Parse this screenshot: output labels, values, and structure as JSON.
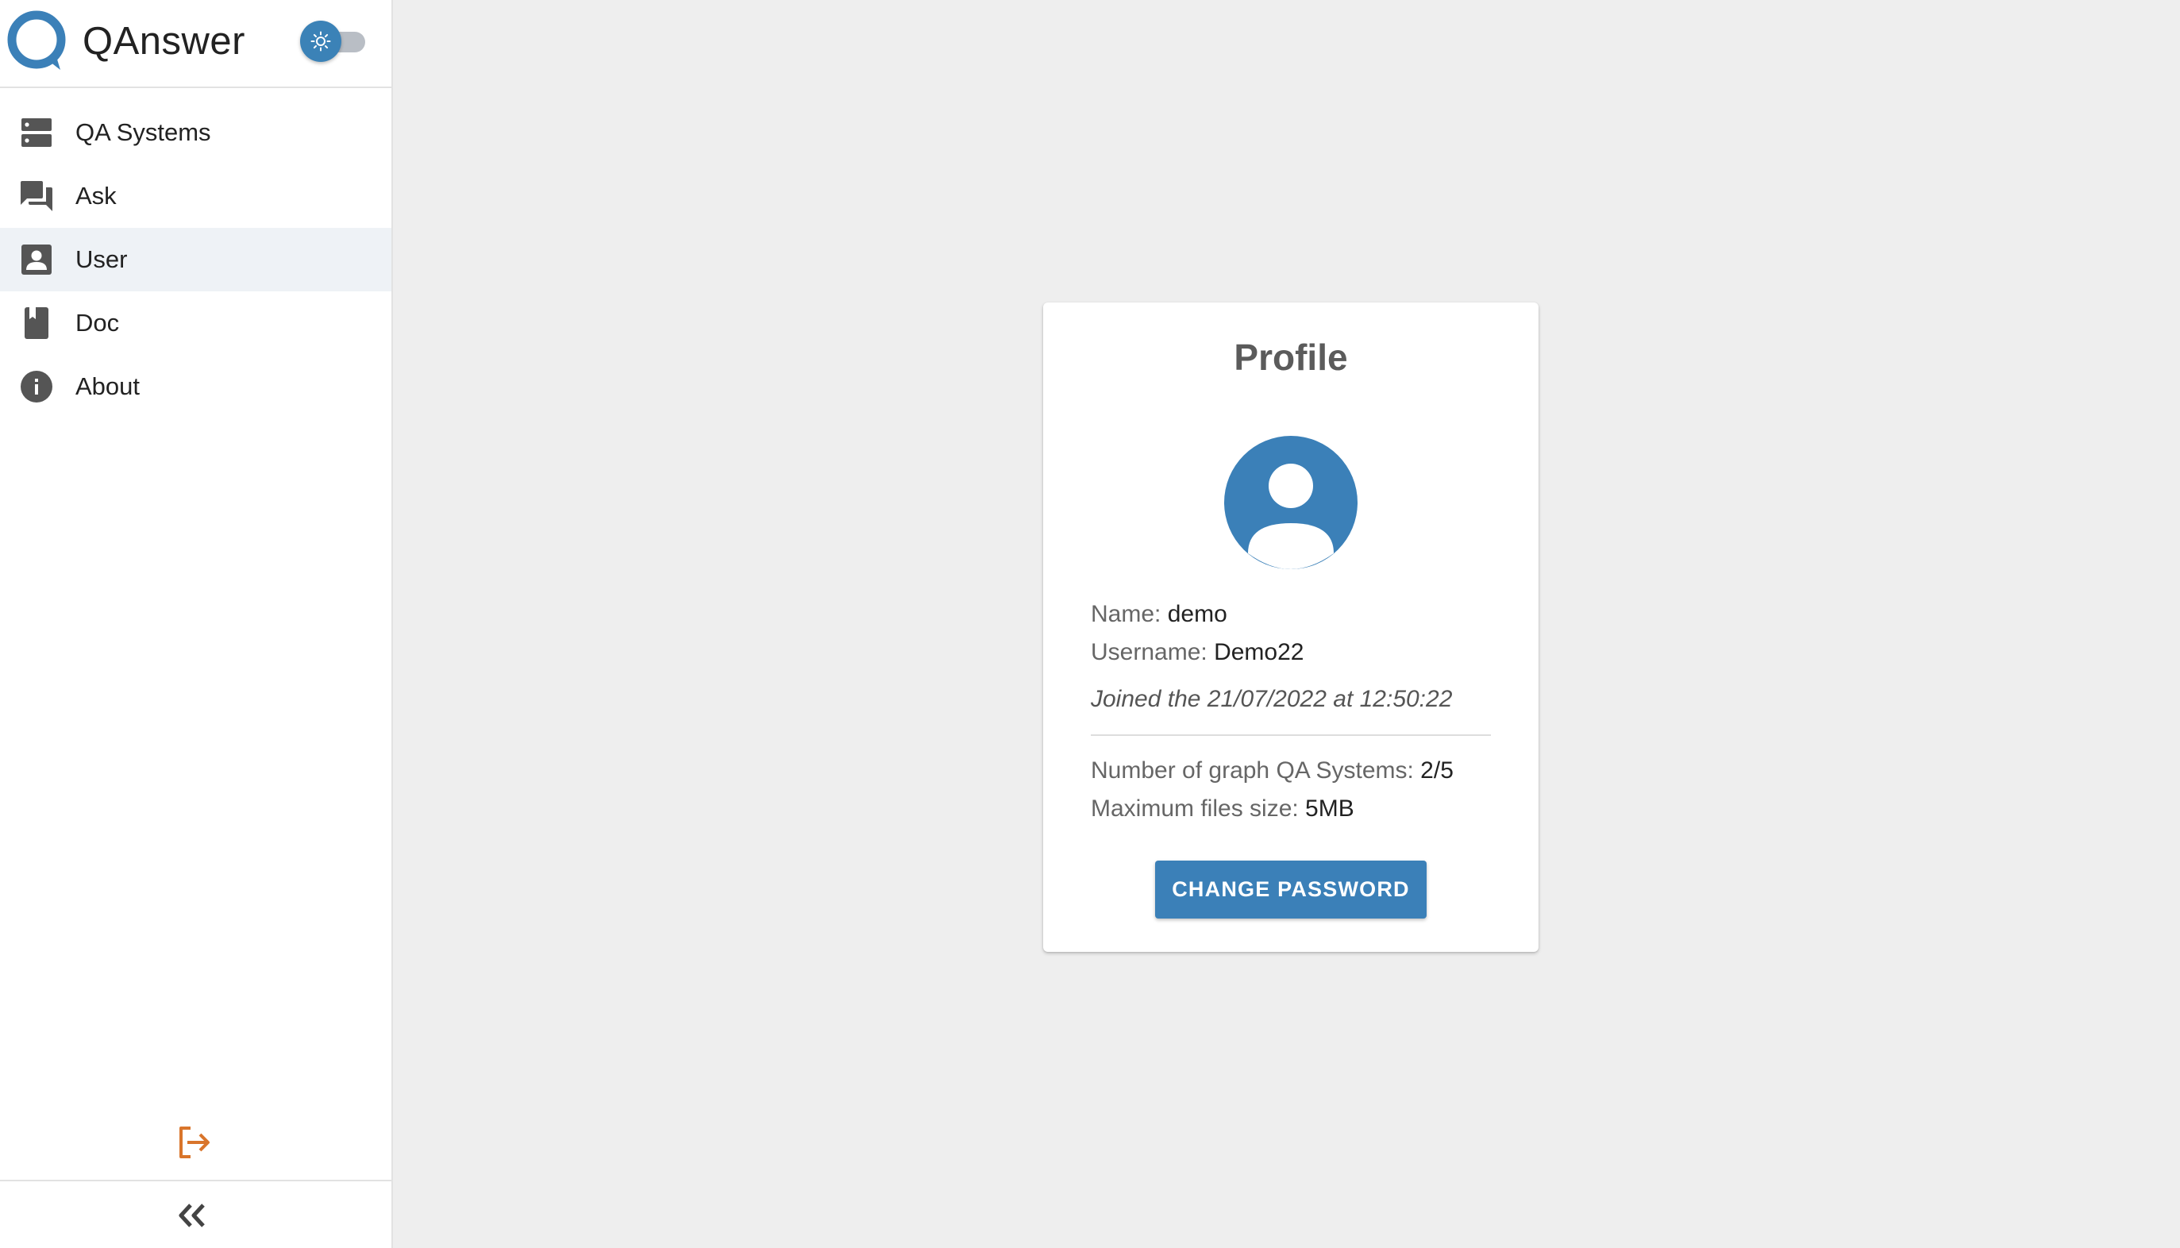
{
  "app": {
    "title": "QAnswer",
    "accent_color": "#3b80b8",
    "logout_color": "#d9752b",
    "theme_toggle": {
      "mode": "light",
      "icon": "sun-icon"
    }
  },
  "sidebar": {
    "items": [
      {
        "label": "QA Systems",
        "icon": "storage-icon",
        "active": false
      },
      {
        "label": "Ask",
        "icon": "forum-icon",
        "active": false
      },
      {
        "label": "User",
        "icon": "account-box-icon",
        "active": true
      },
      {
        "label": "Doc",
        "icon": "book-icon",
        "active": false
      },
      {
        "label": "About",
        "icon": "info-icon",
        "active": false
      }
    ],
    "logout_icon": "logout-icon",
    "collapse_icon": "double-chevron-left-icon"
  },
  "profile": {
    "title": "Profile",
    "avatar_icon": "account-circle-icon",
    "name_label": "Name: ",
    "name_value": "demo",
    "username_label": "Username: ",
    "username_value": "Demo22",
    "joined_text": "Joined the 21/07/2022 at 12:50:22",
    "graph_label": "Number of graph QA Systems: ",
    "graph_value": "2/5",
    "max_size_label": "Maximum files size: ",
    "max_size_value": "5MB",
    "change_password_label": "CHANGE PASSWORD"
  }
}
